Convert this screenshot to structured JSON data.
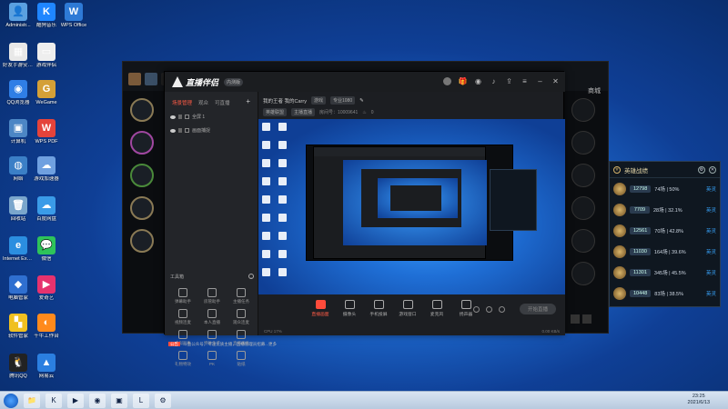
{
  "desktop": {
    "icons": [
      {
        "label": "Administr...",
        "color": "#5aa0e0",
        "glyph": "👤"
      },
      {
        "label": "酷狗音乐",
        "color": "#1f86ff",
        "glyph": "K"
      },
      {
        "label": "WPS Office",
        "color": "#2e7ad6",
        "glyph": "W"
      },
      {
        "label": "好友手游安全问题表",
        "color": "#e8e8e8",
        "glyph": "▦"
      },
      {
        "label": "游戏伴侣",
        "color": "#eeeeee",
        "glyph": "▭"
      },
      {
        "label": "QQ浏览器",
        "color": "#2f7ee6",
        "glyph": "◉"
      },
      {
        "label": "WeGame",
        "color": "#d4a037",
        "glyph": "G"
      },
      {
        "label": "计算机",
        "color": "#4c86c5",
        "glyph": "▣"
      },
      {
        "label": "WPS PDF",
        "color": "#e4433b",
        "glyph": "W"
      },
      {
        "label": "网络",
        "color": "#3b7fc6",
        "glyph": "◍"
      },
      {
        "label": "游戏加速器",
        "color": "#6fa0e0",
        "glyph": "☁"
      },
      {
        "label": "回收站",
        "color": "#7aa6cc",
        "glyph": "🗑"
      },
      {
        "label": "百度网盘",
        "color": "#3a9be8",
        "glyph": "☁"
      },
      {
        "label": "Internet Explorer",
        "color": "#2b8ee0",
        "glyph": "e"
      },
      {
        "label": "微信",
        "color": "#2ec35a",
        "glyph": "💬"
      },
      {
        "label": "电脑管家",
        "color": "#2f6fd0",
        "glyph": "◆"
      },
      {
        "label": "爱奇艺",
        "color": "#e6326e",
        "glyph": "▶"
      },
      {
        "label": "软件管家",
        "color": "#f0c020",
        "glyph": "▚"
      },
      {
        "label": "千牛工作台",
        "color": "#ff8a1c",
        "glyph": "◐"
      },
      {
        "label": "腾讯QQ",
        "color": "#222222",
        "glyph": "🐧"
      },
      {
        "label": "网易云",
        "color": "#2b7fe0",
        "glyph": "▲"
      }
    ]
  },
  "taskbar": {
    "apps": [
      "📁",
      "K",
      "▶",
      "◉",
      "▣",
      "L",
      "⚙"
    ],
    "time": "23:25",
    "date": "2021/6/13"
  },
  "game_window": {
    "right_tab": "商城"
  },
  "stats_panel": {
    "title": "英雄战绩",
    "rows": [
      {
        "score": "12798",
        "record": "74场 | 50%",
        "detail": "英灵"
      },
      {
        "score": "7709",
        "record": "28场 | 32.1%",
        "detail": "英灵"
      },
      {
        "score": "12561",
        "record": "70场 | 42.8%",
        "detail": "英灵"
      },
      {
        "score": "11030",
        "record": "164场 | 39.6%",
        "detail": "英灵"
      },
      {
        "score": "11301",
        "record": "345场 | 45.5%",
        "detail": "英灵"
      },
      {
        "score": "10448",
        "record": "83场 | 38.5%",
        "detail": "英灵"
      }
    ]
  },
  "stream_app": {
    "title": "直播伴侣",
    "badge": "内测版",
    "tabs": [
      "场景管理",
      "观众",
      "可直播"
    ],
    "scenes": [
      "全屏 1",
      "画面捕捉"
    ],
    "tools_title": "工具箱",
    "tools": [
      "弹幕助手",
      "房管助手",
      "主播任务",
      "视频连麦",
      "本人直播",
      "观众连麦",
      "虚拟形象",
      "特效盒子",
      "直播商品",
      "礼物特效",
      "PK",
      "贴纸"
    ],
    "notice_tag": "公告",
    "notice": "斗鱼公众号，专注优质主播，直播管理员招募...更多",
    "room_name": "我的王者 我的Carry",
    "category": "游戏",
    "quality": "专业1080",
    "room_tags": [
      "英雄联盟",
      "主播直播"
    ],
    "room_id": "房间号：10009641",
    "viewers": "0",
    "bottom_buttons": [
      {
        "label": "直播画面",
        "live": true
      },
      {
        "label": "摄像头",
        "live": false
      },
      {
        "label": "手机投屏",
        "live": false
      },
      {
        "label": "游戏窗口",
        "live": false
      },
      {
        "label": "麦克风",
        "live": false
      },
      {
        "label": "扬声器",
        "live": false
      }
    ],
    "start_button": "开始直播",
    "status_left": "CPU 17%",
    "status_right": "0.00 KB/s"
  }
}
